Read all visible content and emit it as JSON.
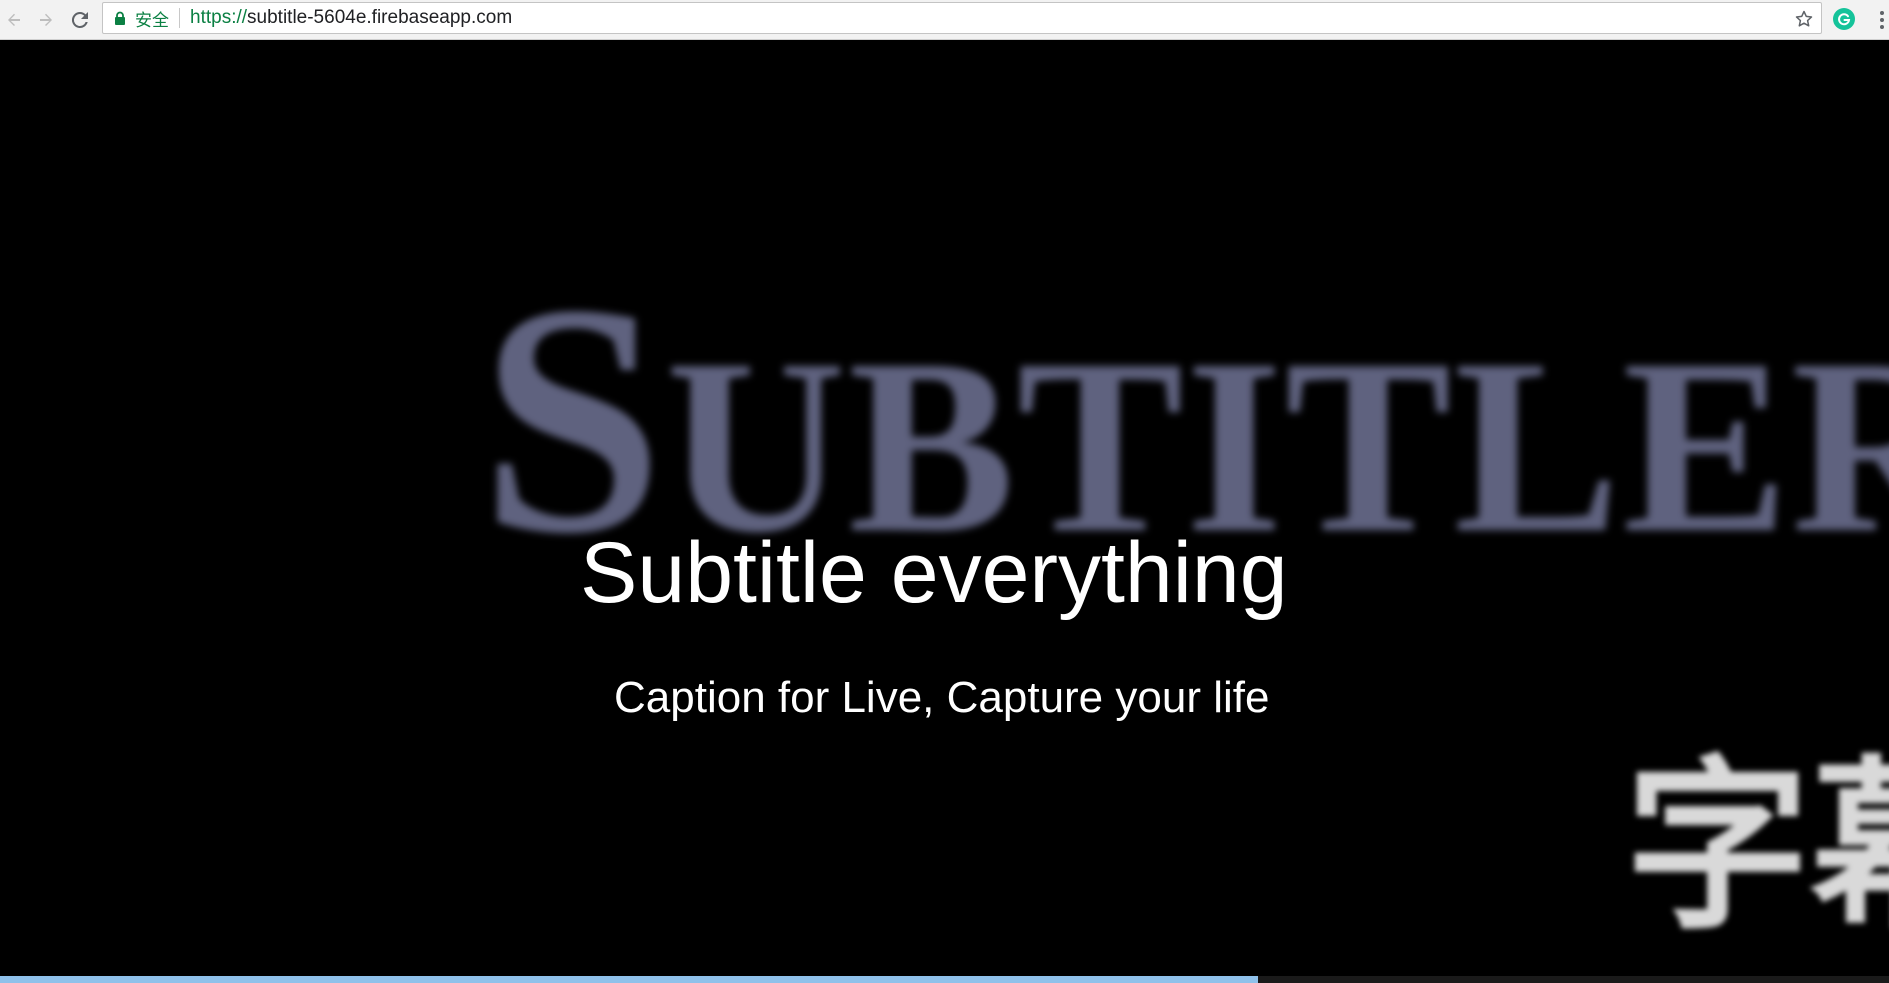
{
  "browser": {
    "secure_label": "安全",
    "url_scheme": "https://",
    "url_host": "subtitle-5604e.firebaseapp.com"
  },
  "hero": {
    "logo_initial": "S",
    "logo_rest": "UBTITLER",
    "cjk_text": "字幕",
    "headline": "Subtitle everything",
    "tagline": "Caption for Live, Capture your life"
  },
  "progress": {
    "fraction": 0.666
  },
  "colors": {
    "secure_green": "#0b8043",
    "logo_color": "#5f627f",
    "progress_color": "#8fc1ea"
  }
}
